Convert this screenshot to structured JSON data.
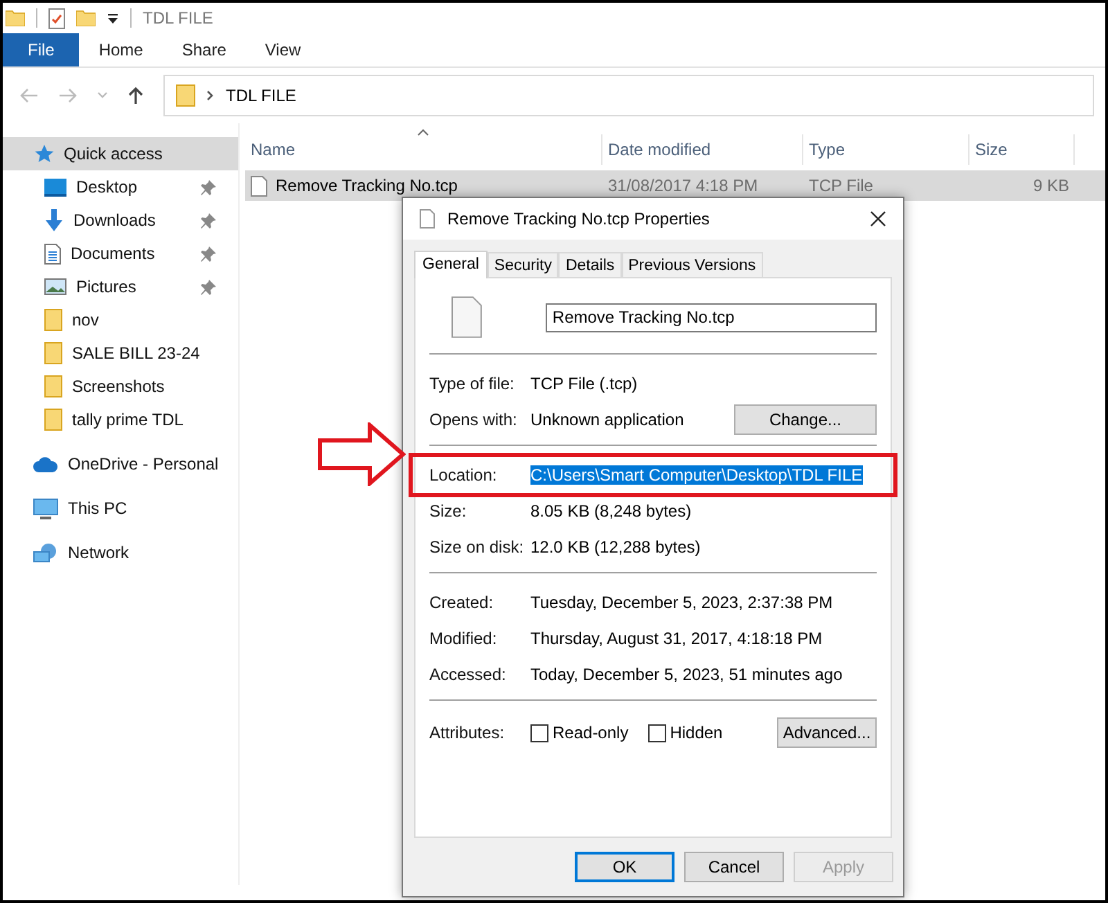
{
  "window": {
    "title": "TDL FILE"
  },
  "ribbon_tabs": [
    {
      "label": "File",
      "selected": true
    },
    {
      "label": "Home",
      "selected": false
    },
    {
      "label": "Share",
      "selected": false
    },
    {
      "label": "View",
      "selected": false
    }
  ],
  "address_bar": {
    "path": "TDL FILE"
  },
  "nav_pane": {
    "items": [
      {
        "label": "Quick access",
        "kind": "star",
        "pinned": false,
        "selected": true,
        "group_start": true
      },
      {
        "label": "Desktop",
        "kind": "desktop",
        "pinned": true,
        "selected": false,
        "group_start": false
      },
      {
        "label": "Downloads",
        "kind": "download",
        "pinned": true,
        "selected": false,
        "group_start": false
      },
      {
        "label": "Documents",
        "kind": "documents",
        "pinned": true,
        "selected": false,
        "group_start": false
      },
      {
        "label": "Pictures",
        "kind": "pictures",
        "pinned": true,
        "selected": false,
        "group_start": false
      },
      {
        "label": "nov",
        "kind": "folder",
        "pinned": false,
        "selected": false,
        "group_start": false
      },
      {
        "label": "SALE BILL 23-24",
        "kind": "folder",
        "pinned": false,
        "selected": false,
        "group_start": false
      },
      {
        "label": "Screenshots",
        "kind": "folder",
        "pinned": false,
        "selected": false,
        "group_start": false
      },
      {
        "label": "tally prime TDL",
        "kind": "folder",
        "pinned": false,
        "selected": false,
        "group_start": false
      },
      {
        "label": "OneDrive - Personal",
        "kind": "cloud",
        "pinned": false,
        "selected": false,
        "group_start": true
      },
      {
        "label": "This PC",
        "kind": "pc",
        "pinned": false,
        "selected": false,
        "group_start": true
      },
      {
        "label": "Network",
        "kind": "network",
        "pinned": false,
        "selected": false,
        "group_start": true
      }
    ]
  },
  "file_list": {
    "columns": [
      "Name",
      "Date modified",
      "Type",
      "Size"
    ],
    "rows": [
      {
        "name": "Remove Tracking No.tcp",
        "date_modified": "31/08/2017 4:18 PM",
        "type": "TCP File",
        "size": "9 KB",
        "selected": true
      }
    ]
  },
  "dialog": {
    "title": "Remove Tracking No.tcp Properties",
    "tabs": [
      {
        "label": "General",
        "selected": true
      },
      {
        "label": "Security",
        "selected": false
      },
      {
        "label": "Details",
        "selected": false
      },
      {
        "label": "Previous Versions",
        "selected": false
      }
    ],
    "file_name": "Remove Tracking No.tcp",
    "sections": [
      [
        {
          "label": "Type of file:",
          "value": "TCP File (.tcp)",
          "annotated": false,
          "text_selected": false
        },
        {
          "label": "Opens with:",
          "value": "Unknown application",
          "button": "Change...",
          "annotated": false,
          "text_selected": false
        }
      ],
      [
        {
          "label": "Location:",
          "value": "C:\\Users\\Smart Computer\\Desktop\\TDL FILE",
          "annotated": true,
          "text_selected": true
        },
        {
          "label": "Size:",
          "value": "8.05 KB (8,248 bytes)",
          "annotated": false,
          "text_selected": false
        },
        {
          "label": "Size on disk:",
          "value": "12.0 KB (12,288 bytes)",
          "annotated": false,
          "text_selected": false
        }
      ],
      [
        {
          "label": "Created:",
          "value": "Tuesday, December 5, 2023, 2:37:38 PM",
          "annotated": false,
          "text_selected": false
        },
        {
          "label": "Modified:",
          "value": "Thursday, August 31, 2017, 4:18:18 PM",
          "annotated": false,
          "text_selected": false
        },
        {
          "label": "Accessed:",
          "value": "Today, December 5, 2023, 51 minutes ago",
          "annotated": false,
          "text_selected": false
        }
      ]
    ],
    "attributes": {
      "label": "Attributes:",
      "checkboxes": [
        {
          "label": "Read-only",
          "checked": false
        },
        {
          "label": "Hidden",
          "checked": false
        }
      ],
      "button": "Advanced..."
    },
    "buttons": [
      {
        "label": "OK",
        "kind": "default"
      },
      {
        "label": "Cancel",
        "kind": "normal"
      },
      {
        "label": "Apply",
        "kind": "disabled"
      }
    ]
  }
}
